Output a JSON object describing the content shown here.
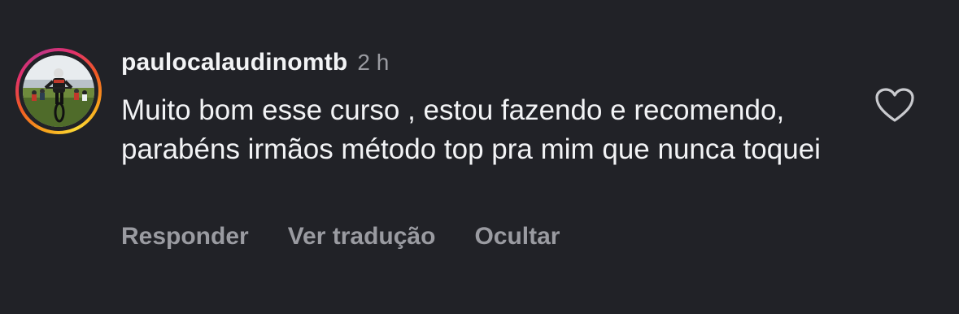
{
  "comment": {
    "username": "paulocalaudinomtb",
    "time": "2 h",
    "text": "Muito bom esse curso , estou fazendo e recomendo, parabéns irmãos método top pra mim que nunca toquei",
    "avatar_icon": "profile-photo-mountain-bike",
    "like_icon": "heart-outline-icon"
  },
  "actions": {
    "reply": "Responder",
    "translate": "Ver tradução",
    "hide": "Ocultar"
  },
  "colors": {
    "background": "#212227",
    "text": "#f2f3f5",
    "muted": "#9a9ba1"
  }
}
